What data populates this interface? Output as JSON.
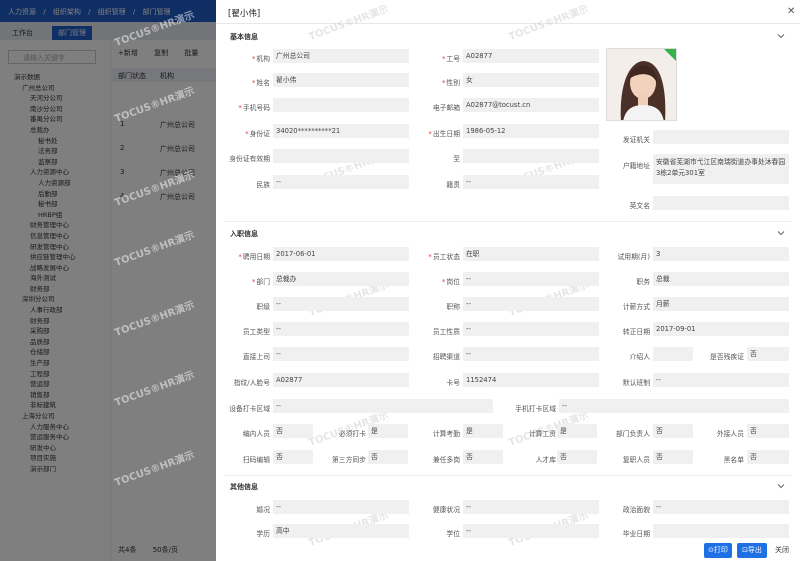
{
  "background": {
    "breadcrumb": [
      "人力资源",
      "/",
      "组织架构",
      "/",
      "组织管理",
      "/",
      "部门管理"
    ],
    "tabs": [
      "工作台",
      "部门管理"
    ],
    "search_placeholder": "请输入关键字",
    "tree": [
      "演示数据",
      "广州总公司",
      "天河分公司",
      "南沙分公司",
      "番禺分公司",
      "总裁办",
      "秘书处",
      "法务部",
      "监察部",
      "人力资源中心",
      "人力资源部",
      "后勤部",
      "秘书部",
      "HRBP组",
      "财务管理中心",
      "信息管理中心",
      "研发管理中心",
      "供应链管理中心",
      "战略发展中心",
      "海外测试",
      "财务部",
      "深圳分公司",
      "人事行政部",
      "财务部",
      "采购部",
      "品质部",
      "仓储部",
      "生产部",
      "工程部",
      "营运部",
      "销售部",
      "非标建筑",
      "上海分公司",
      "人力服务中心",
      "营运服务中心",
      "研发中心",
      "项目实施",
      "演示部门"
    ],
    "toolbar": [
      "+新增",
      "复制",
      "批量"
    ],
    "table_header": [
      "部门状态",
      "机构"
    ],
    "rows": [
      {
        "no": "1",
        "org": "广州总公司"
      },
      {
        "no": "2",
        "org": "广州总公司"
      },
      {
        "no": "3",
        "org": "广州总公司"
      },
      {
        "no": "4",
        "org": "广州总公司"
      }
    ],
    "footer": [
      "共4条",
      "50条/页"
    ]
  },
  "watermark": "TOCUS®HR演示",
  "drawer": {
    "title": "[翟小伟]",
    "sections": {
      "basic": "基本信息",
      "entry": "入职信息",
      "other": "其他信息"
    },
    "basic": {
      "org_label": "机构",
      "org": "广州总公司",
      "empno_label": "工号",
      "empno": "A02877",
      "name_label": "姓名",
      "name": "翟小伟",
      "gender_label": "性别",
      "gender": "女",
      "phone_label": "手机号码",
      "phone": "",
      "email_label": "电子邮箱",
      "email": "A02877@tocust.cn",
      "idcard_label": "身份证",
      "idcard": "34020**********21",
      "birth_label": "出生日期",
      "birth": "1986-05-12",
      "issuer_label": "发证机关",
      "issuer": "",
      "idvalid_label": "身份证有效期",
      "idvalid": "",
      "to_label": "至",
      "to": "",
      "household_label": "户籍地址",
      "household": "安徽省芜湖市弋江区南瑞街道办事处沐春园3栋2单元301室",
      "ethnic_label": "民族",
      "ethnic": "--",
      "native_label": "籍贯",
      "native": "--",
      "engname_label": "英文名",
      "engname": ""
    },
    "entry": {
      "hire_label": "聘用日期",
      "hire": "2017-06-01",
      "status_label": "员工状态",
      "status": "在职",
      "probation_label": "试用期(月)",
      "probation": "3",
      "dept_label": "部门",
      "dept": "总裁办",
      "post_label": "岗位",
      "post": "--",
      "duty_label": "职务",
      "duty": "总裁",
      "rank_label": "职级",
      "rank": "--",
      "title_label": "职称",
      "title": "--",
      "salary_label": "计薪方式",
      "salary": "月薪",
      "emptype_label": "员工类型",
      "emptype": "--",
      "empnature_label": "员工性质",
      "empnature": "--",
      "regular_label": "转正日期",
      "regular": "2017-09-01",
      "boss_label": "直接上司",
      "boss": "--",
      "channel_label": "招聘渠道",
      "channel": "--",
      "referrer_label": "介绍人",
      "referrer": "",
      "disabled_label": "是否残疾证",
      "disabled": "否",
      "finger_label": "指纹/人脸号",
      "finger": "A02877",
      "card_label": "卡号",
      "card": "1152474",
      "shift_label": "默认班制",
      "shift": "--",
      "device_label": "设备打卡区域",
      "device": "--",
      "mobile_label": "手机打卡区域",
      "mobile": "--",
      "staffed_label": "编内人员",
      "staffed": "否",
      "mustclock_label": "必须打卡",
      "mustclock": "是",
      "attendance_label": "计算考勤",
      "attendance": "是",
      "wage_label": "计算工资",
      "wage": "是",
      "depthead_label": "部门负责人",
      "depthead": "否",
      "outsource_label": "外接人员",
      "outsource": "否",
      "scan_label": "扫码编辑",
      "scan": "否",
      "thirdsync_label": "第三方同步",
      "thirdsync": "否",
      "multipost_label": "兼任多岗",
      "multipost": "否",
      "talent_label": "人才库",
      "talent": "否",
      "rehire_label": "复职人员",
      "rehire": "否",
      "blacklist_label": "黑名单",
      "blacklist": "否"
    },
    "other": {
      "marital_label": "婚况",
      "marital": "--",
      "health_label": "健康状况",
      "health": "--",
      "political_label": "政治面貌",
      "political": "--",
      "edu_label": "学历",
      "edu": "高中",
      "degree_label": "学位",
      "degree": "--",
      "grad_label": "毕业日期",
      "grad": ""
    },
    "buttons": {
      "print": "⊙打印",
      "export": "⊡导出",
      "close": "关闭"
    }
  }
}
